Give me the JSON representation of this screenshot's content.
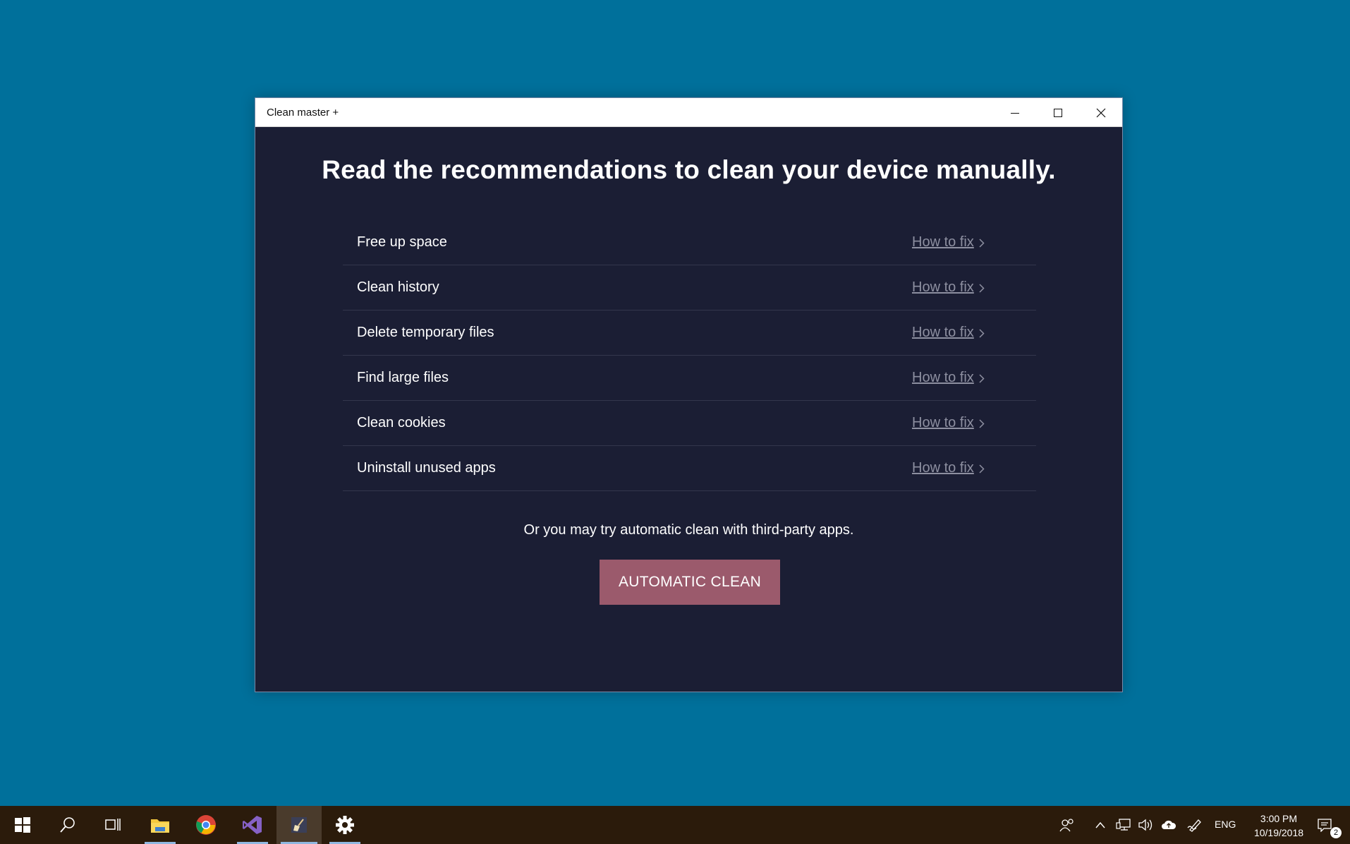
{
  "window": {
    "title": "Clean master +",
    "headline": "Read the recommendations to clean your device manually.",
    "recommendations": [
      {
        "label": "Free up space",
        "action": "How to fix"
      },
      {
        "label": "Clean history",
        "action": "How to fix"
      },
      {
        "label": "Delete temporary files",
        "action": "How to fix"
      },
      {
        "label": "Find large files",
        "action": "How to fix"
      },
      {
        "label": "Clean cookies",
        "action": "How to fix"
      },
      {
        "label": "Uninstall unused apps",
        "action": "How to fix"
      }
    ],
    "subtext": "Or you may try automatic clean with third-party apps.",
    "primary_button": "AUTOMATIC CLEAN"
  },
  "taskbar": {
    "pinned": [
      "windows-start-icon",
      "search-icon",
      "task-view-icon",
      "file-explorer-icon",
      "chrome-icon",
      "visual-studio-icon",
      "clean-master-icon",
      "settings-gear-icon"
    ],
    "tray": {
      "language": "ENG",
      "time": "3:00 PM",
      "date": "10/19/2018",
      "notification_count": "2"
    }
  },
  "colors": {
    "desktop": "#00709b",
    "window_bg": "#1b1e34",
    "button": "#9b5a6c",
    "taskbar": "#2b1b0b"
  }
}
